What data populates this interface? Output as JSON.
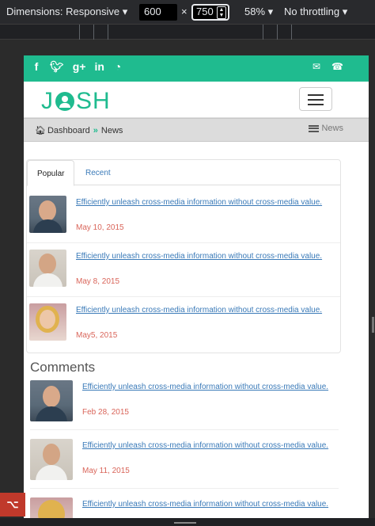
{
  "devtools": {
    "dimensions_label": "Dimensions: Responsive",
    "width": "600",
    "times": "×",
    "height": "750",
    "zoom": "58%",
    "throttle": "No throttling"
  },
  "topbar": {
    "social": [
      "f",
      "t",
      "g+",
      "in",
      "rss"
    ],
    "contact": [
      "mail",
      "phone"
    ]
  },
  "logo": {
    "left": "J",
    "right": "SH"
  },
  "breadcrumb": {
    "home": "Dashboard",
    "current": "News",
    "right": "News"
  },
  "tabs": {
    "popular": "Popular",
    "recent": "Recent"
  },
  "popular_items": [
    {
      "title": "Efficiently unleash cross-media information without cross-media value.",
      "date": "May 10, 2015"
    },
    {
      "title": "Efficiently unleash cross-media information without cross-media value.",
      "date": "May 8, 2015"
    },
    {
      "title": "Efficiently unleash cross-media information without cross-media value.",
      "date": "May5, 2015"
    }
  ],
  "comments": {
    "title": "Comments",
    "items": [
      {
        "title": "Efficiently unleash cross-media information without cross-media value.",
        "date": "Feb 28, 2015"
      },
      {
        "title": "Efficiently unleash cross-media information without cross-media value.",
        "date": "May 11, 2015"
      },
      {
        "title": "Efficiently unleash cross-media information without cross-media value.",
        "date": ""
      }
    ]
  },
  "colors": {
    "brand": "#1fbb8f",
    "link": "#3a7ab8",
    "date": "#d9655a"
  }
}
